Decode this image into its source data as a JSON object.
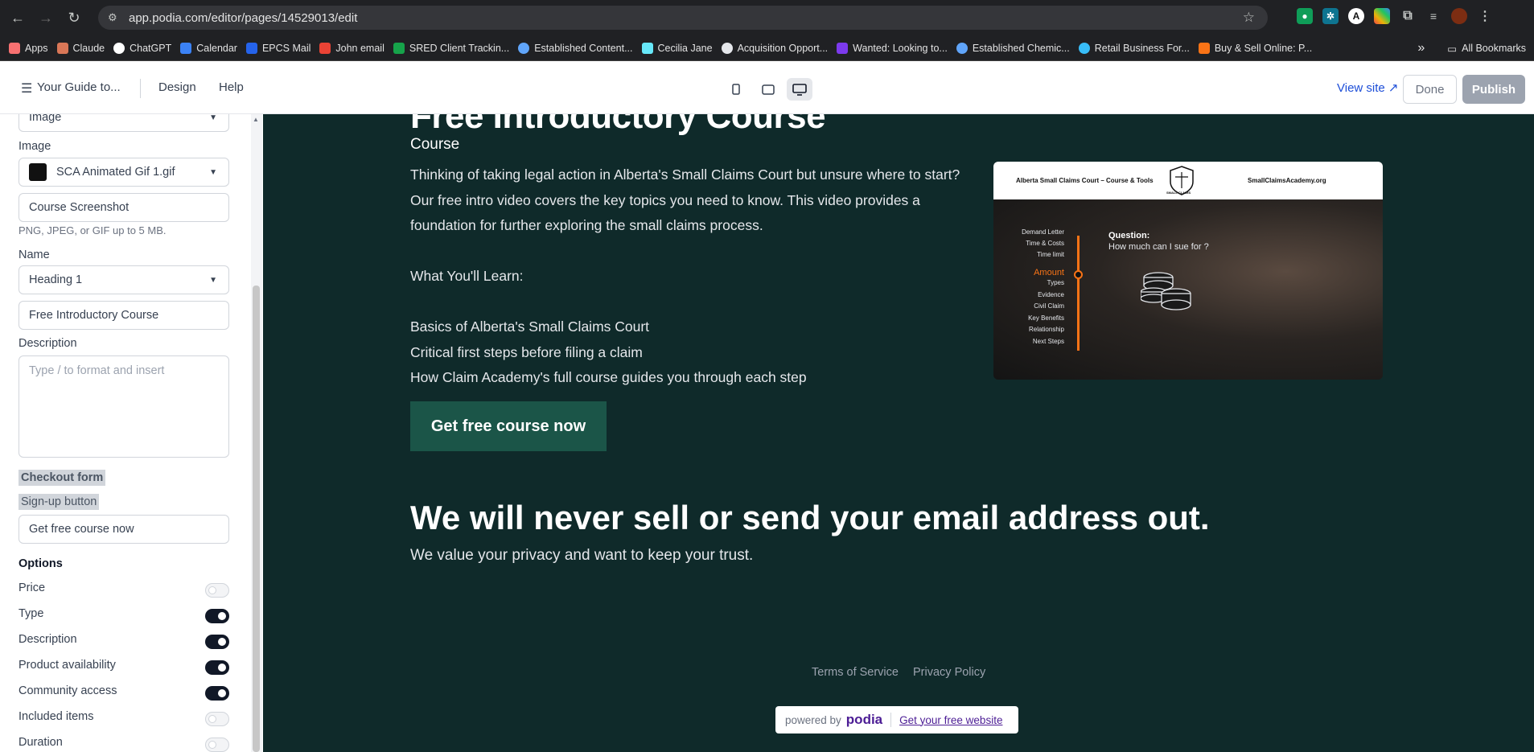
{
  "browser": {
    "url": "app.podia.com/editor/pages/14529013/edit",
    "bookmarks": [
      "Apps",
      "Claude",
      "ChatGPT",
      "Calendar",
      "EPCS Mail",
      "John email",
      "SRED Client Trackin...",
      "Established Content...",
      "Cecilia Jane",
      "Acquisition Opport...",
      "Wanted: Looking to...",
      "Established Chemic...",
      "Retail Business For...",
      "Buy & Sell Online: P..."
    ],
    "more_bookmarks": "»",
    "all_bookmarks": "All Bookmarks"
  },
  "editor": {
    "menu_title": "Your Guide to...",
    "design": "Design",
    "help": "Help",
    "view_site": "View site ↗",
    "done": "Done",
    "publish": "Publish"
  },
  "sidebar": {
    "type_select": "Image",
    "image_label": "Image",
    "image_file": "SCA Animated Gif 1.gif",
    "alt_text": "Course Screenshot",
    "image_hint": "PNG, JPEG, or GIF up to 5 MB.",
    "name_label": "Name",
    "heading_select": "Heading 1",
    "name_value": "Free Introductory Course",
    "description_label": "Description",
    "description_placeholder": "Type / to format and insert",
    "checkout_form": "Checkout form",
    "signup_button_label": "Sign-up button",
    "signup_button_value": "Get free course now",
    "options_label": "Options",
    "options": [
      {
        "label": "Price",
        "on": false
      },
      {
        "label": "Type",
        "on": true
      },
      {
        "label": "Description",
        "on": true
      },
      {
        "label": "Product availability",
        "on": true
      },
      {
        "label": "Community access",
        "on": true
      },
      {
        "label": "Included items",
        "on": false
      },
      {
        "label": "Duration",
        "on": false
      }
    ]
  },
  "preview": {
    "title": "Free Introductory Course",
    "type": "Course",
    "intro": "Thinking of taking legal action in Alberta's Small Claims Court but unsure where to start? Our free intro video covers the key topics you need to know. This video provides a foundation for further exploring the small claims process.",
    "learn_heading": "What You'll Learn:",
    "learn_items": [
      "Basics of Alberta's Small Claims Court",
      "Critical first steps before filing a claim",
      "How Claim Academy's full course guides you through each step"
    ],
    "cta": "Get free course now",
    "privacy_heading": "We will never sell or send your email address out.",
    "privacy_sub": "We value your privacy and want to keep your trust.",
    "terms": "Terms of Service",
    "privacy_policy": "Privacy Policy",
    "powered_by": "powered by",
    "podia": "podia",
    "get_site": "Get your free website",
    "image": {
      "left_header": "Alberta Small Claims Court – Course & Tools",
      "right_header": "SmallClaimsAcademy.org",
      "logo_text": "SMALL CLAIMS",
      "menu": [
        "Demand Letter",
        "Time & Costs",
        "Time limit",
        "Amount",
        "Types",
        "Evidence",
        "Civil Claim",
        "Key Benefits",
        "Relationship",
        "Next Steps"
      ],
      "question_label": "Question:",
      "question": "How much can I sue for ?"
    }
  }
}
